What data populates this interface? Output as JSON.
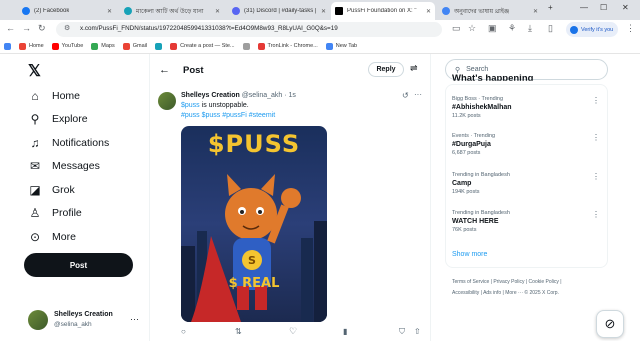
{
  "browser": {
    "tabs": [
      {
        "title": "(2) Facebook",
        "color": "#1877f2"
      },
      {
        "title": "মাকেলা আটি অর্থ উড়ে যানা",
        "color": "#17a2b8"
      },
      {
        "title": "(31) Discord | #daily-tasks |",
        "color": "#5865f2"
      },
      {
        "title": "PussFi Foundation on X: \"",
        "color": "#000000"
      },
      {
        "title": "অনুবাদের ভাষায় থ্রাইঞ্জ",
        "color": "#4285f4"
      }
    ],
    "url": "x.com/PussFi_FNDN/status/1972204859941331038?t=Ed4O9M8w93_R8LyUAI_G0Q&s=19",
    "verify_label": "Verify it's you",
    "bookmarks": [
      {
        "label": "",
        "color": "#4285f4"
      },
      {
        "label": "Home",
        "color": "#ea4335"
      },
      {
        "label": "YouTube",
        "color": "#ff0000"
      },
      {
        "label": "Maps",
        "color": "#34a853"
      },
      {
        "label": "Gmail",
        "color": "#ea4335"
      },
      {
        "label": "",
        "color": "#17a2b8"
      },
      {
        "label": "Create a post — Ste...",
        "color": "#e53935"
      },
      {
        "label": "",
        "color": "#9e9e9e"
      },
      {
        "label": "TronLink - Chrome...",
        "color": "#e53935"
      },
      {
        "label": "New Tab",
        "color": "#4285f4"
      }
    ]
  },
  "sidebar": {
    "items": [
      {
        "label": "Home",
        "icon": "home-icon"
      },
      {
        "label": "Explore",
        "icon": "search-icon"
      },
      {
        "label": "Notifications",
        "icon": "bell-icon"
      },
      {
        "label": "Messages",
        "icon": "mail-icon"
      },
      {
        "label": "Grok",
        "icon": "grok-icon"
      },
      {
        "label": "Profile",
        "icon": "person-icon"
      },
      {
        "label": "More",
        "icon": "more-circle-icon"
      }
    ],
    "post_label": "Post",
    "account": {
      "name": "Shelleys Creation",
      "handle": "@selina_akh"
    }
  },
  "main": {
    "header_title": "Post",
    "reply_label": "Reply",
    "tweet": {
      "author": "Shelleys Creation",
      "handle": "@selina_akh",
      "sep": "·",
      "time": "1s",
      "cashtag": "$puss",
      "text": " is unstoppable.",
      "tags": "#puss $puss #pussFi #steemit",
      "image_title": "$PUSS",
      "image_caption": "$ REAL"
    }
  },
  "right": {
    "search_placeholder": "Search",
    "section_title": "What's happening",
    "trends": [
      {
        "context": "Bigg Boss · Trending",
        "name": "#AbhishekMalhan",
        "count": "11.2K posts"
      },
      {
        "context": "Events · Trending",
        "name": "#DurgaPuja",
        "count": "6,687 posts"
      },
      {
        "context": "Trending in Bangladesh",
        "name": "Camp",
        "count": "194K posts"
      },
      {
        "context": "Trending in Bangladesh",
        "name": "WATCH HERE",
        "count": "76K posts"
      }
    ],
    "show_more": "Show more",
    "footer_links": [
      "Terms of Service",
      "|",
      "Privacy Policy",
      "|",
      "Cookie Policy",
      "|"
    ],
    "footer_links2": [
      "Accessibility",
      "|",
      "Ads info",
      "|",
      "More ···",
      "© 2025 X Corp."
    ]
  }
}
